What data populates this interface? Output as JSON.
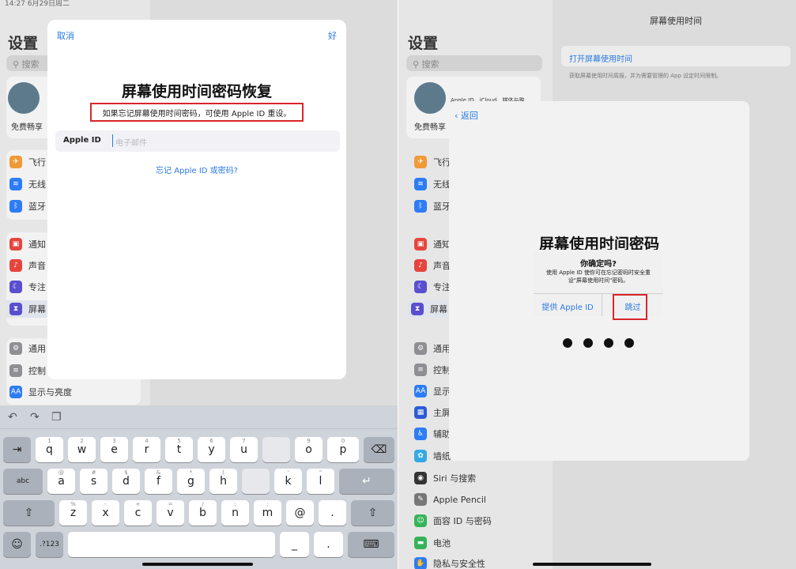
{
  "left": {
    "status": "14:27  6月29日周二",
    "settings_title": "设置",
    "search_placeholder": "搜索",
    "free_text": "免费畅享",
    "sidebar_items": [
      "飞行",
      "无线",
      "蓝牙",
      "通知",
      "声音",
      "专注",
      "屏幕",
      "通用",
      "控制",
      "显示与亮度"
    ],
    "modal": {
      "cancel": "取消",
      "done": "好",
      "title": "屏幕使用时间密码恢复",
      "subtitle": "如果忘记屏幕使用时间密码，可使用 Apple ID 重设。",
      "field_label": "Apple ID",
      "field_placeholder": "电子邮件",
      "forgot_link": "忘记 Apple ID 或密码?"
    },
    "keyboard": {
      "row1": [
        {
          "l": "q",
          "n": "1"
        },
        {
          "l": "w",
          "n": "2"
        },
        {
          "l": "e",
          "n": "3"
        },
        {
          "l": "r",
          "n": "4"
        },
        {
          "l": "t",
          "n": "5"
        },
        {
          "l": "y",
          "n": "6"
        },
        {
          "l": "u",
          "n": "7"
        },
        {
          "l": "o",
          "n": "9"
        },
        {
          "l": "p",
          "n": "0"
        }
      ],
      "row2": [
        {
          "l": "a",
          "n": "@"
        },
        {
          "l": "s",
          "n": "#"
        },
        {
          "l": "d",
          "n": "$"
        },
        {
          "l": "f",
          "n": "&"
        },
        {
          "l": "g",
          "n": "*"
        },
        {
          "l": "h",
          "n": "("
        },
        {
          "l": "k",
          "n": "'"
        },
        {
          "l": "l",
          "n": "\""
        }
      ],
      "row3": [
        {
          "l": "z",
          "n": "%"
        },
        {
          "l": "x",
          "n": "-"
        },
        {
          "l": "c",
          "n": "+"
        },
        {
          "l": "v",
          "n": "="
        },
        {
          "l": "b",
          "n": "/"
        },
        {
          "l": "n",
          "n": ";"
        },
        {
          "l": "m",
          "n": ":"
        },
        {
          "l": "@",
          "n": ""
        },
        {
          "l": ".",
          "n": ""
        }
      ],
      "tab": "⇥",
      "abc": "abc",
      "shift": "⇧",
      "globe": "☺",
      "num": ".?123",
      "underscore": "_",
      "dot": ".",
      "delete": "⌫",
      "return": "↵",
      "kbd": "⌨",
      "undo": "↶",
      "redo": "↷",
      "paste": "❐"
    }
  },
  "right": {
    "settings_title": "设置",
    "search_placeholder": "搜索",
    "free_text": "免费畅享",
    "account_sub": "Apple ID、iCloud、媒体与购",
    "screen_title": "屏幕使用时间",
    "open_link": "打开屏幕使用时间",
    "desc": "获取屏幕使用时间周报，并为需要管理的 App 设定时间限制。",
    "back": "返回",
    "passcode_title": "屏幕使用时间密码",
    "alert": {
      "title": "你确定吗?",
      "message": "使用 Apple ID 使你可在忘记密码时安全重设\"屏幕使用时间\"密码。",
      "provide": "提供 Apple ID",
      "skip": "跳过"
    },
    "sidebar_items": [
      "飞行",
      "无线",
      "蓝牙",
      "通知",
      "声音",
      "专注",
      "屏幕",
      "通用",
      "控制",
      "显示",
      "主屏",
      "辅助",
      "墙纸",
      "Siri 与搜索",
      "Apple Pencil",
      "面容 ID 与密码",
      "电池",
      "隐私与安全性"
    ]
  },
  "colors": {
    "accent": "#2a7ae2",
    "highlight": "#d9262b"
  }
}
